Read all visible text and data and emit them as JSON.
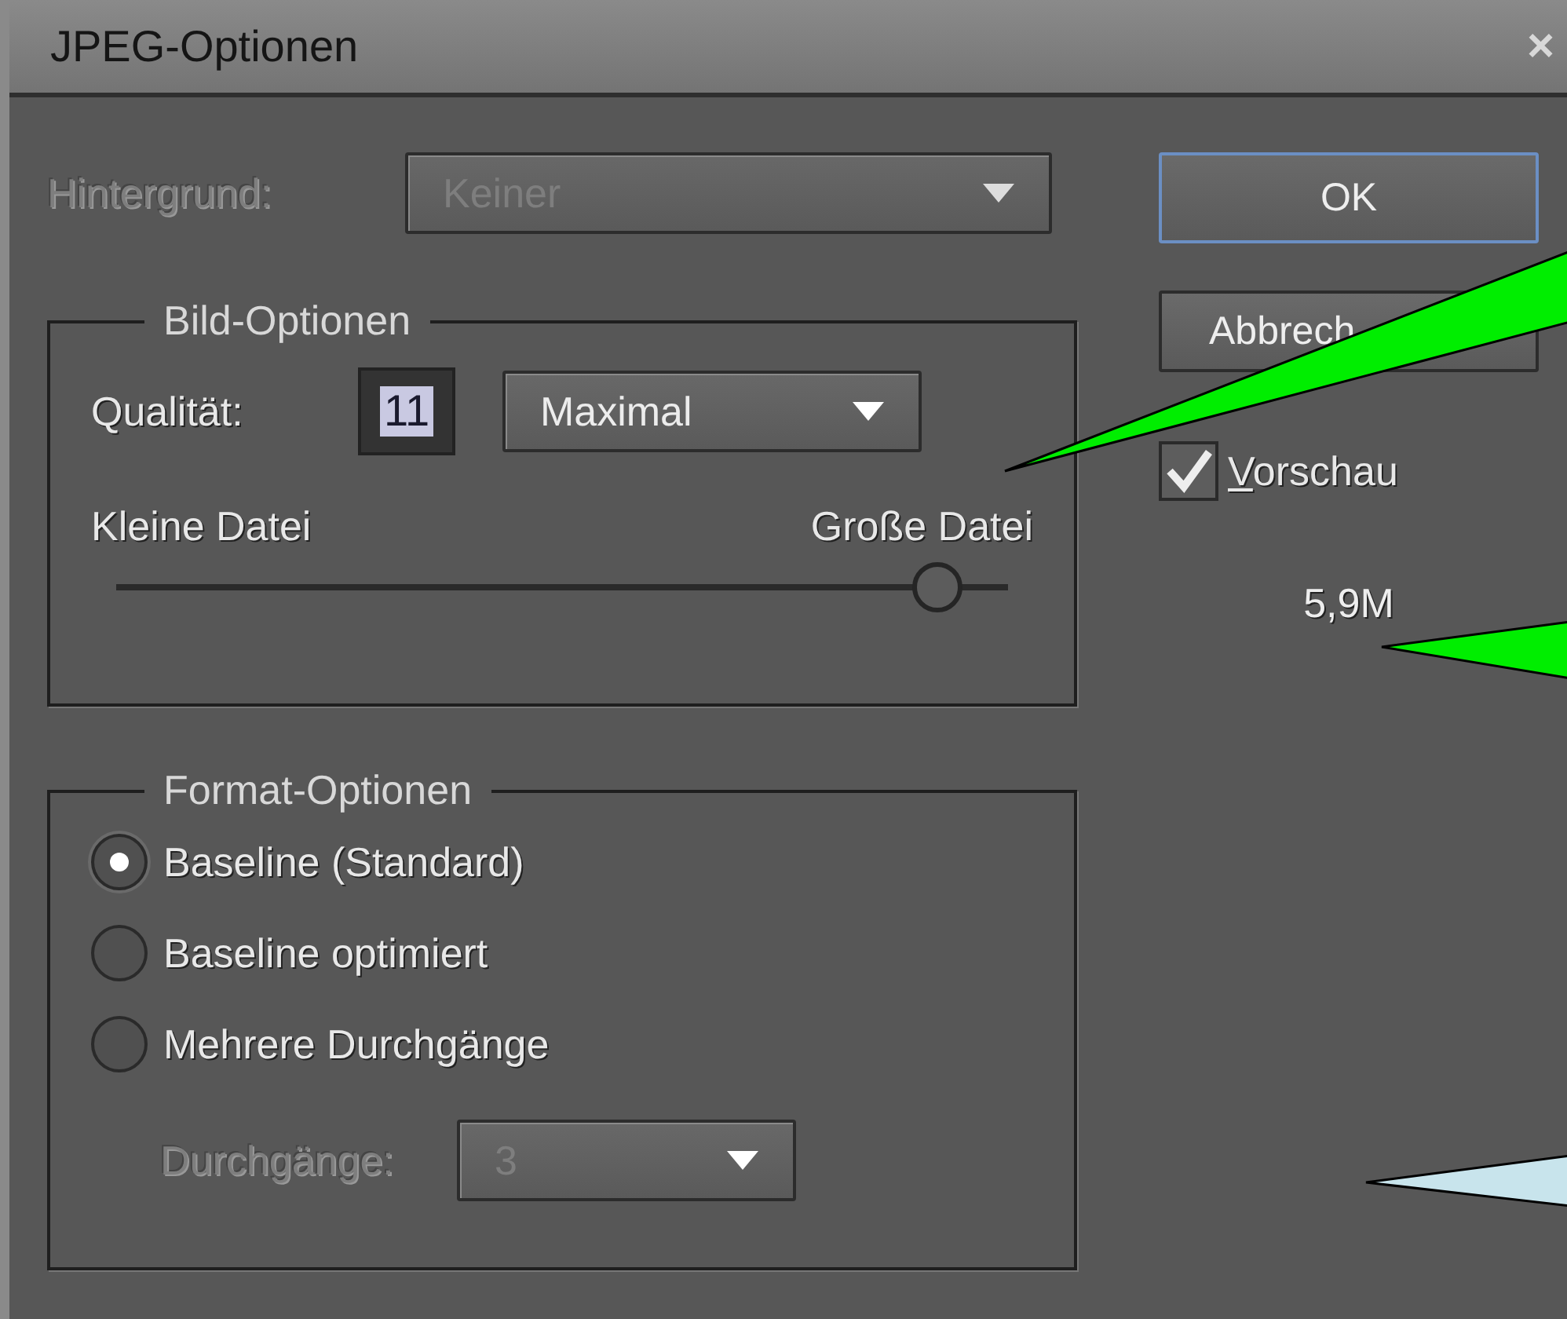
{
  "window": {
    "title": "JPEG-Optionen",
    "close": "×"
  },
  "background": {
    "label": "Hintergrund:",
    "value": "Keiner",
    "disabled": true
  },
  "image_options": {
    "title": "Bild-Optionen",
    "quality_label": "Qualität:",
    "quality_value": "11",
    "quality_preset": "Maximal",
    "small_label": "Kleine Datei",
    "large_label": "Große Datei",
    "level": 0.92
  },
  "format_options": {
    "title": "Format-Optionen",
    "choices": [
      {
        "label": "Baseline (Standard)",
        "selected": true
      },
      {
        "label": "Baseline optimiert",
        "selected": false
      },
      {
        "label": "Mehrere Durchgänge",
        "selected": false
      }
    ],
    "passes": {
      "label": "Durchgänge:",
      "value": "3",
      "disabled": true
    }
  },
  "buttons": [
    {
      "label": "OK",
      "default": true
    },
    {
      "label": "Abbrech",
      "default": false
    }
  ],
  "preview": {
    "label": "Vorschau",
    "checked": true
  },
  "file_size": "5,9M",
  "callouts": [
    {
      "color": "#00ee00"
    },
    {
      "color": "#00ee00"
    },
    {
      "color": "#c8e4ec"
    }
  ]
}
